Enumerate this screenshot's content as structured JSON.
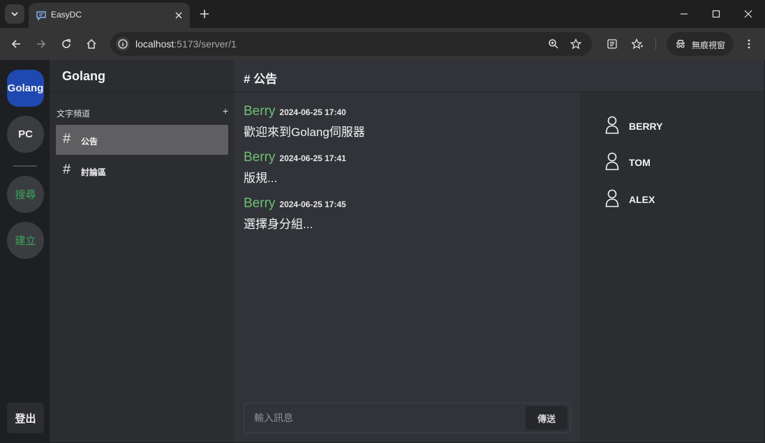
{
  "browser": {
    "tab_title": "EasyDC",
    "url_host": "localhost",
    "url_rest": ":5173/server/1",
    "incognito_label": "無痕視窗"
  },
  "servers": [
    {
      "label": "Golang",
      "active": true
    },
    {
      "label": "PC",
      "active": false
    }
  ],
  "rail_actions": {
    "search_label": "搜尋",
    "create_label": "建立",
    "logout_label": "登出"
  },
  "sidebar": {
    "server_name": "Golang",
    "category_label": "文字頻道",
    "add_label": "+",
    "channels": [
      {
        "hash": "#",
        "name": "公告",
        "active": true
      },
      {
        "hash": "#",
        "name": "討論區",
        "active": false
      }
    ]
  },
  "main": {
    "title": "# 公告",
    "messages": [
      {
        "author": "Berry",
        "time": "2024-06-25 17:40",
        "text": "歡迎來到Golang伺服器"
      },
      {
        "author": "Berry",
        "time": "2024-06-25 17:41",
        "text": "版規..."
      },
      {
        "author": "Berry",
        "time": "2024-06-25 17:45",
        "text": "選擇身分組..."
      }
    ],
    "input_placeholder": "輸入訊息",
    "send_label": "傳送"
  },
  "members": [
    "BERRY",
    "TOM",
    "ALEX"
  ],
  "colors": {
    "accent_server": "#1f49b0",
    "author_green": "#6fbf73",
    "rail_green": "#3ba55c"
  }
}
